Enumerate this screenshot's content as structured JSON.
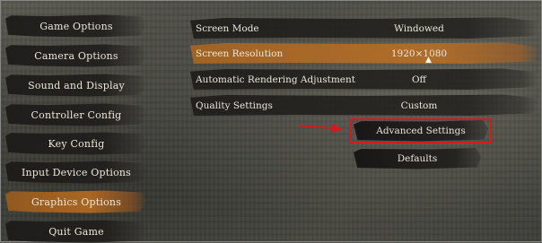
{
  "sidebar": {
    "items": [
      {
        "label": "Game Options",
        "active": false
      },
      {
        "label": "Camera Options",
        "active": false
      },
      {
        "label": "Sound and Display",
        "active": false
      },
      {
        "label": "Controller Config",
        "active": false
      },
      {
        "label": "Key Config",
        "active": false
      },
      {
        "label": "Input Device Options",
        "active": false
      },
      {
        "label": "Graphics Options",
        "active": true
      },
      {
        "label": "Quit Game",
        "active": false
      }
    ]
  },
  "settings": [
    {
      "label": "Screen Mode",
      "value": "Windowed"
    },
    {
      "label": "Screen Resolution",
      "value": "1920×1080"
    },
    {
      "label": "Automatic Rendering Adjustment",
      "value": "Off"
    },
    {
      "label": "Quality Settings",
      "value": "Custom"
    }
  ],
  "buttons": {
    "advanced_label": "Advanced Settings",
    "defaults_label": "Defaults"
  },
  "colors": {
    "accent_orange": "#b06a24",
    "annotation_red": "#d01c1c",
    "panel_dark": "#1e1c1a"
  }
}
